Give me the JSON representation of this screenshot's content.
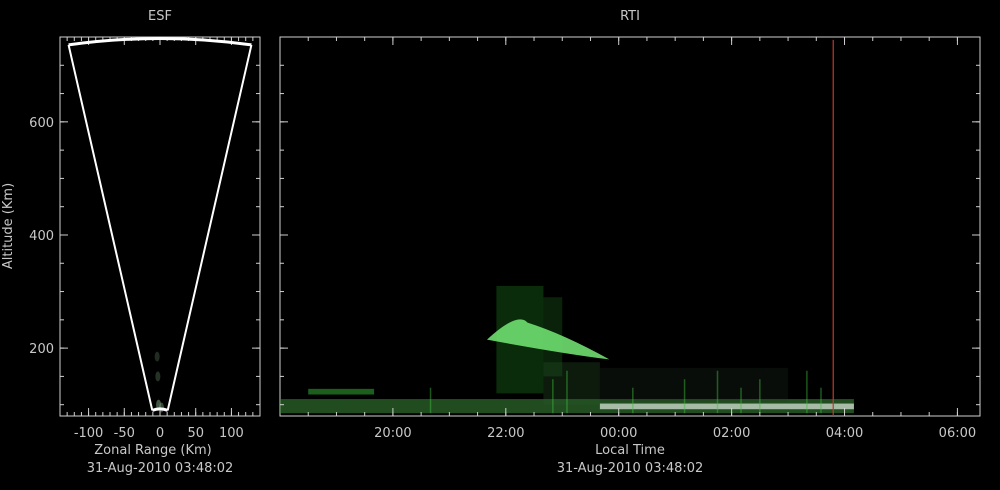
{
  "chart_data": [
    {
      "type": "scatter",
      "title": "ESF",
      "xlabel": "Zonal Range (Km)",
      "ylabel": "Altitude (Km)",
      "timestamp": "31-Aug-2010 03:48:02",
      "xlim": [
        -140,
        140
      ],
      "ylim": [
        80,
        750
      ],
      "x_ticks": [
        -100,
        -50,
        0,
        50,
        100
      ],
      "x_tick_labels": [
        "-100",
        "-50",
        "0",
        "50",
        "100"
      ],
      "y_ticks": [
        200,
        400,
        600
      ],
      "y_tick_labels": [
        "200",
        "400",
        "600"
      ],
      "beam_fan": {
        "range_min_km": 90,
        "range_max_km": 748,
        "left_edge_top_x": -128,
        "right_edge_top_x": 128,
        "color": "#ffffff"
      },
      "echoes": [
        {
          "x": -2,
          "y": 100,
          "intensity": 0.6
        },
        {
          "x": -3,
          "y": 150,
          "intensity": 0.35
        },
        {
          "x": -4,
          "y": 185,
          "intensity": 0.3
        },
        {
          "x": 2,
          "y": 95,
          "intensity": 0.5
        }
      ],
      "grid": false
    },
    {
      "type": "heatmap",
      "title": "RTI",
      "xlabel": "Local Time",
      "timestamp": "31-Aug-2010 03:48:02",
      "x_unit": "hours since 18:00 local",
      "xlim": [
        18.0,
        30.4
      ],
      "ylim": [
        80,
        750
      ],
      "x_ticks": [
        "20:00",
        "22:00",
        "00:00",
        "02:00",
        "04:00",
        "06:00"
      ],
      "y_ticks": [
        200,
        400,
        600
      ],
      "current_time": "03:48",
      "current_time_color": "#c0392b",
      "echo_color": "#3fbf3f",
      "regions": [
        {
          "t0": "18:00",
          "t1": "04:10",
          "alt0": 85,
          "alt1": 110,
          "intensity": 0.55,
          "color": "#3a8a3a"
        },
        {
          "t0": "23:40",
          "t1": "04:10",
          "alt0": 92,
          "alt1": 102,
          "intensity": 0.8,
          "color": "#c8d8c8"
        },
        {
          "t0": "18:30",
          "t1": "19:40",
          "alt0": 118,
          "alt1": 128,
          "intensity": 0.6,
          "color": "#2f9f2f"
        },
        {
          "t0": "21:50",
          "t1": "22:40",
          "alt0": 120,
          "alt1": 310,
          "intensity": 0.35,
          "color": "#1f7f1f"
        },
        {
          "t0": "22:40",
          "t1": "23:00",
          "alt0": 150,
          "alt1": 290,
          "intensity": 0.3,
          "color": "#1f6f1f"
        },
        {
          "t0": "22:40",
          "t1": "23:40",
          "alt0": 100,
          "alt1": 175,
          "intensity": 0.3,
          "color": "#2a5a2a"
        },
        {
          "t0": "23:40",
          "t1": "03:00",
          "alt0": 105,
          "alt1": 165,
          "intensity": 0.22,
          "color": "#2b3b2b"
        }
      ],
      "bubble": {
        "t0": "21:40",
        "t1": "23:50",
        "alt_center": 215,
        "alt_peak": 245,
        "intensity": 0.9,
        "color": "#6fdf6f"
      },
      "grid": false
    }
  ]
}
